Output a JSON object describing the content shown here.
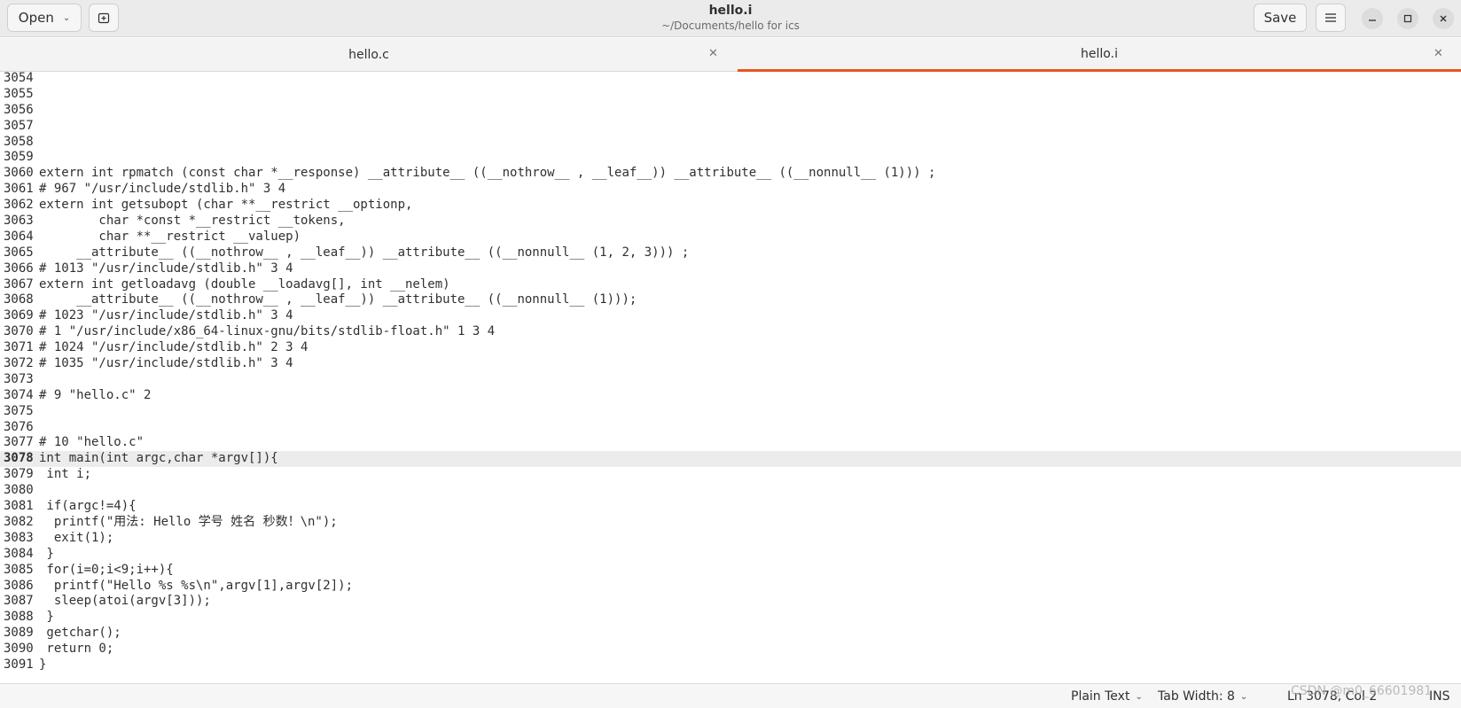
{
  "header": {
    "open_label": "Open",
    "title": "hello.i",
    "subtitle": "~/Documents/hello for ics",
    "save_label": "Save"
  },
  "tabs": [
    {
      "label": "hello.c"
    },
    {
      "label": "hello.i"
    }
  ],
  "editor": {
    "lines": [
      {
        "num": "3054",
        "text": ""
      },
      {
        "num": "3055",
        "text": ""
      },
      {
        "num": "3056",
        "text": ""
      },
      {
        "num": "3057",
        "text": ""
      },
      {
        "num": "3058",
        "text": ""
      },
      {
        "num": "3059",
        "text": ""
      },
      {
        "num": "3060",
        "text": "extern int rpmatch (const char *__response) __attribute__ ((__nothrow__ , __leaf__)) __attribute__ ((__nonnull__ (1))) ;"
      },
      {
        "num": "3061",
        "text": "# 967 \"/usr/include/stdlib.h\" 3 4"
      },
      {
        "num": "3062",
        "text": "extern int getsubopt (char **__restrict __optionp,"
      },
      {
        "num": "3063",
        "text": "        char *const *__restrict __tokens,"
      },
      {
        "num": "3064",
        "text": "        char **__restrict __valuep)"
      },
      {
        "num": "3065",
        "text": "     __attribute__ ((__nothrow__ , __leaf__)) __attribute__ ((__nonnull__ (1, 2, 3))) ;"
      },
      {
        "num": "3066",
        "text": "# 1013 \"/usr/include/stdlib.h\" 3 4"
      },
      {
        "num": "3067",
        "text": "extern int getloadavg (double __loadavg[], int __nelem)"
      },
      {
        "num": "3068",
        "text": "     __attribute__ ((__nothrow__ , __leaf__)) __attribute__ ((__nonnull__ (1)));"
      },
      {
        "num": "3069",
        "text": "# 1023 \"/usr/include/stdlib.h\" 3 4"
      },
      {
        "num": "3070",
        "text": "# 1 \"/usr/include/x86_64-linux-gnu/bits/stdlib-float.h\" 1 3 4"
      },
      {
        "num": "3071",
        "text": "# 1024 \"/usr/include/stdlib.h\" 2 3 4"
      },
      {
        "num": "3072",
        "text": "# 1035 \"/usr/include/stdlib.h\" 3 4"
      },
      {
        "num": "3073",
        "text": ""
      },
      {
        "num": "3074",
        "text": "# 9 \"hello.c\" 2"
      },
      {
        "num": "3075",
        "text": ""
      },
      {
        "num": "3076",
        "text": ""
      },
      {
        "num": "3077",
        "text": "# 10 \"hello.c\""
      },
      {
        "num": "3078",
        "text": "int main(int argc,char *argv[]){"
      },
      {
        "num": "3079",
        "text": " int i;"
      },
      {
        "num": "3080",
        "text": ""
      },
      {
        "num": "3081",
        "text": " if(argc!=4){"
      },
      {
        "num": "3082",
        "text": "  printf(\"用法: Hello 学号 姓名 秒数！\\n\");"
      },
      {
        "num": "3083",
        "text": "  exit(1);"
      },
      {
        "num": "3084",
        "text": " }"
      },
      {
        "num": "3085",
        "text": " for(i=0;i<9;i++){"
      },
      {
        "num": "3086",
        "text": "  printf(\"Hello %s %s\\n\",argv[1],argv[2]);"
      },
      {
        "num": "3087",
        "text": "  sleep(atoi(argv[3]));"
      },
      {
        "num": "3088",
        "text": " }"
      },
      {
        "num": "3089",
        "text": " getchar();"
      },
      {
        "num": "3090",
        "text": " return 0;"
      },
      {
        "num": "3091",
        "text": "}"
      }
    ],
    "current_line": "3078"
  },
  "statusbar": {
    "language": "Plain Text",
    "tab_width": "Tab Width: 8",
    "position": "Ln 3078, Col 2",
    "mode": "INS"
  },
  "watermark": "CSDN @m0_66601981",
  "colors": {
    "accent": "#e95420",
    "current_line_bg": "#ececec"
  }
}
